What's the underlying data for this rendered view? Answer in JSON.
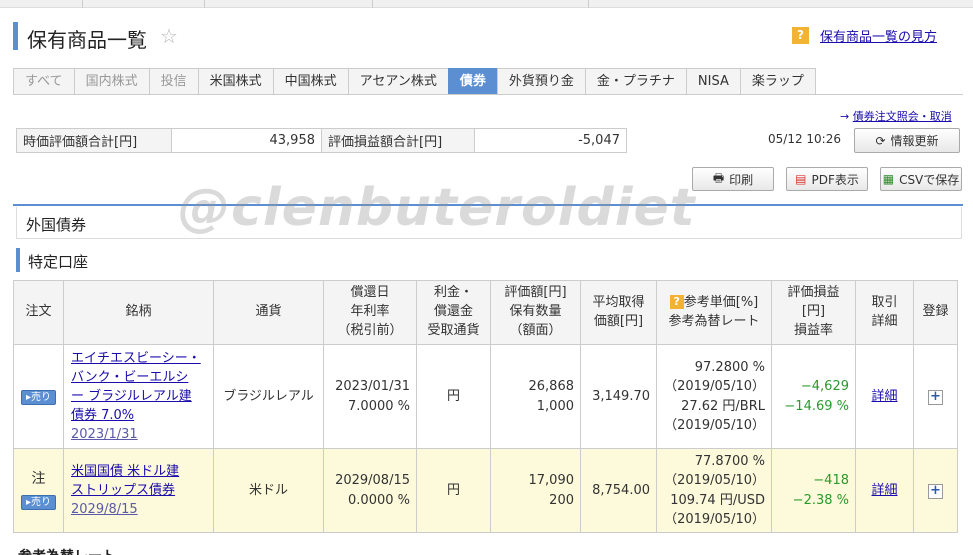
{
  "page": {
    "title": "保有商品一覧",
    "help_icon": "?",
    "help_link": "保有商品一覧の見方"
  },
  "tabs": [
    {
      "label": "すべて",
      "state": "dim"
    },
    {
      "label": "国内株式",
      "state": "dim"
    },
    {
      "label": "投信",
      "state": "dim"
    },
    {
      "label": "米国株式",
      "state": "normal"
    },
    {
      "label": "中国株式",
      "state": "normal"
    },
    {
      "label": "アセアン株式",
      "state": "normal"
    },
    {
      "label": "債券",
      "state": "active"
    },
    {
      "label": "外貨預り金",
      "state": "normal"
    },
    {
      "label": "金・プラチナ",
      "state": "normal"
    },
    {
      "label": "NISA",
      "state": "normal"
    },
    {
      "label": "楽ラップ",
      "state": "normal"
    }
  ],
  "order_link": "債券注文照会・取消",
  "summary": {
    "market_value_label": "時価評価額合計[円]",
    "market_value": "43,958",
    "pl_label": "評価損益額合計[円]",
    "pl_value": "-5,047"
  },
  "datetime": "05/12 10:26",
  "buttons": {
    "refresh": "情報更新",
    "print": "印刷",
    "pdf": "PDF表示",
    "csv": "CSVで保存"
  },
  "section_title": "外国債券",
  "account_title": "特定口座",
  "watermark": "@clenbuteroldiet",
  "table": {
    "headers": {
      "order": "注文",
      "name": "銘柄",
      "currency": "通貨",
      "redemption": [
        "償還日",
        "年利率",
        "（税引前）"
      ],
      "interest": [
        "利金・",
        "償還金",
        "受取通貨"
      ],
      "valuation": [
        "評価額[円]",
        "保有数量",
        "（額面）"
      ],
      "avg_cost": [
        "平均取得",
        "価額[円]"
      ],
      "ref_price": [
        "参考単価[%]",
        "参考為替レート"
      ],
      "pl": [
        "評価損益",
        "[円]",
        "損益率"
      ],
      "trade": [
        "取引",
        "詳細"
      ],
      "register": "登録"
    },
    "rows": [
      {
        "order_mark": "",
        "sell_badge": "売り",
        "name_lines": [
          "エイチエスビーシー・",
          "バンク・ビーエルシ",
          "ー ブラジルレアル建",
          "債券 7.0%"
        ],
        "due": "2023/1/31",
        "currency": "ブラジルレアル",
        "redemption_date": "2023/01/31",
        "rate": "7.0000 %",
        "interest_currency": "円",
        "valuation": "26,868",
        "quantity": "1,000",
        "avg_cost": "3,149.70",
        "ref_price": "97.2800 %",
        "ref_price_date": "（2019/05/10）",
        "fx_rate": "27.62 円/BRL",
        "fx_date": "（2019/05/10）",
        "pl": "−4,629",
        "pl_rate": "−14.69 %",
        "detail": "詳細"
      },
      {
        "order_mark": "注",
        "sell_badge": "売り",
        "name_lines": [
          "米国国債 米ドル建",
          "ストリップス債券"
        ],
        "due": "2029/8/15",
        "currency": "米ドル",
        "redemption_date": "2029/08/15",
        "rate": "0.0000 %",
        "interest_currency": "円",
        "valuation": "17,090",
        "quantity": "200",
        "avg_cost": "8,754.00",
        "ref_price": "77.8700 %",
        "ref_price_date": "（2019/05/10）",
        "fx_rate": "109.74 円/USD",
        "fx_date": "（2019/05/10）",
        "pl": "−418",
        "pl_rate": "−2.38 %",
        "detail": "詳細"
      }
    ]
  },
  "footer_cut": "参考為替レート",
  "colors": {
    "accent": "#5b8fd1",
    "negative": "#2a9a2a",
    "highlight_row": "#fdf9db",
    "help": "#f2b233"
  }
}
